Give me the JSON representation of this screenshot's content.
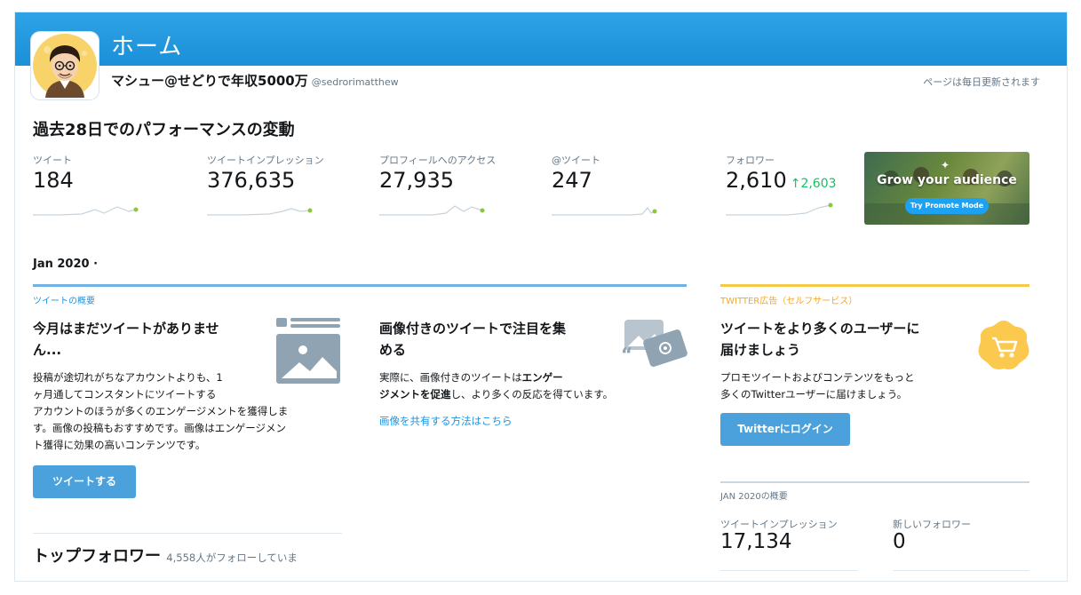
{
  "header": {
    "title": "ホーム",
    "username": "マシュー@せどりで年収5000万",
    "handle": "@sedrorimatthew",
    "update_note": "ページは毎日更新されます"
  },
  "performance": {
    "title": "過去28日でのパフォーマンスの変動",
    "metrics": [
      {
        "label": "ツイート",
        "value": "184"
      },
      {
        "label": "ツイートインプレッション",
        "value": "376,635"
      },
      {
        "label": "プロフィールへのアクセス",
        "value": "27,935"
      },
      {
        "label": "@ツイート",
        "value": "247"
      },
      {
        "label": "フォロワー",
        "value": "2,610",
        "change": "↑2,603"
      }
    ]
  },
  "promo": {
    "title": "Grow your audience",
    "button": "Try Promote Mode"
  },
  "month": {
    "label": "Jan 2020 ·"
  },
  "tweet_summary": {
    "heading": "ツイートの概要",
    "card1": {
      "title_line1": "今月はまだツイートがありませ",
      "title_line2": "ん...",
      "body_lines": [
        "投稿が途切れがちなアカウントよりも、1",
        "ヶ月通してコンスタントにツイートする",
        "アカウントのほうが多くのエンゲージメントを獲得しま",
        "す。画像の投稿もおすすめです。画像はエンゲージメン",
        "ト獲得に効果の高いコンテンツです。"
      ],
      "button": "ツイートする"
    },
    "card2": {
      "title_line1": "画像付きのツイートで注目を集",
      "title_line2": "める",
      "body_line1_a": "実際に、画像付きのツイートは",
      "body_line1_b": "エンゲー",
      "body_line2_a": "ジメントを促進",
      "body_line2_b": "し、より多くの反応を得ています。",
      "link": "画像を共有する方法はこちら"
    }
  },
  "ads": {
    "heading": "TWITTER広告（セルフサービス）",
    "title_line1": "ツイートをより多くのユーザーに",
    "title_line2": "届けましょう",
    "body_line1": "プロモツイートおよびコンテンツをもっと",
    "body_line2": "多くのTwitterユーザーに届けましょう。",
    "button": "Twitterにログイン"
  },
  "monthly_summary": {
    "heading": "JAN 2020の概要",
    "impressions_label": "ツイートインプレッション",
    "impressions_value": "17,134",
    "new_followers_label": "新しいフォロワー",
    "new_followers_value": "0"
  },
  "top_followers": {
    "title": "トップフォロワー",
    "subtitle": "4,558人がフォローしていま"
  },
  "colors": {
    "header_blue": "#1b8fd8",
    "link_blue": "#1b95e0",
    "button_blue": "#4aa1dc",
    "gain_green": "#17bf63",
    "ad_gold": "#f5c84a"
  }
}
